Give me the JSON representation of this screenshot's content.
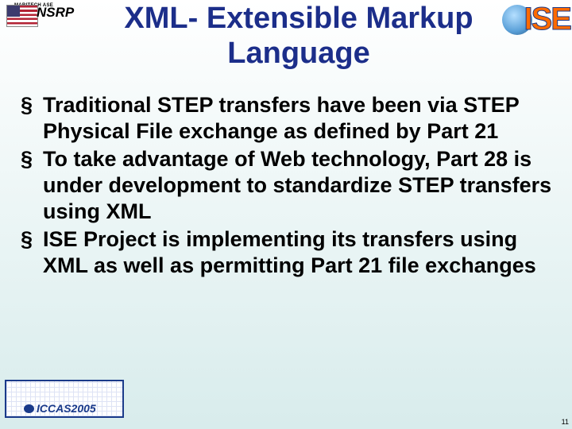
{
  "header": {
    "nsrp_label": "NSRP",
    "nsrp_sub": "MARITECH ASE",
    "ise_label": "ISE"
  },
  "title": "XML- Extensible Markup Language",
  "bullets": [
    "Traditional STEP transfers have been via STEP Physical File exchange as defined by Part 21",
    "To take advantage of Web technology, Part 28 is under development to standardize STEP transfers using XML",
    "ISE Project is implementing its transfers using XML as well as permitting Part 21 file exchanges"
  ],
  "footer": {
    "conference": "ICCAS2005"
  },
  "page_number": "11"
}
